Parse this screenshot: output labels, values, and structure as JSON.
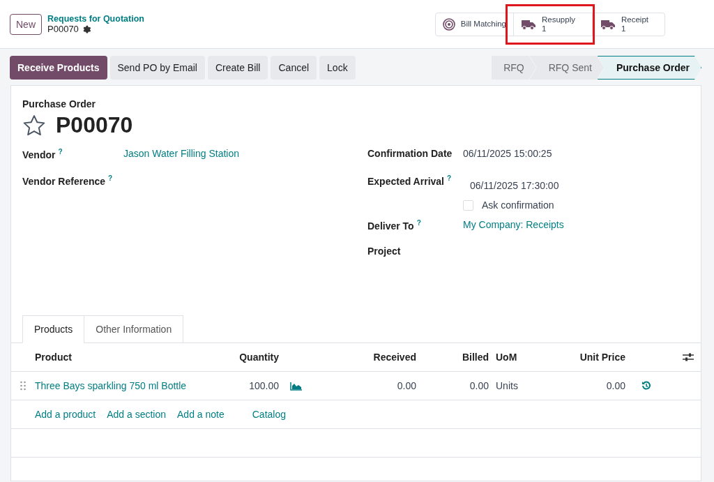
{
  "control_panel": {
    "new_button": "New",
    "breadcrumb_parent": "Requests for Quotation",
    "breadcrumb_current": "P00070"
  },
  "smart_buttons": [
    {
      "kind": "target",
      "label": "Bill Matching",
      "highlighted": false
    },
    {
      "kind": "truck",
      "label": "Resupply",
      "count": "1",
      "highlighted": true
    },
    {
      "kind": "truck",
      "label": "Receipt",
      "count": "1",
      "highlighted": false
    }
  ],
  "actions": [
    {
      "label": "Receive Products",
      "primary": true
    },
    {
      "label": "Send PO by Email",
      "primary": false
    },
    {
      "label": "Create Bill",
      "primary": false
    },
    {
      "label": "Cancel",
      "primary": false
    },
    {
      "label": "Lock",
      "primary": false
    }
  ],
  "status_bar": [
    {
      "label": "RFQ",
      "selected": false
    },
    {
      "label": "RFQ Sent",
      "selected": false
    },
    {
      "label": "Purchase Order",
      "selected": true
    }
  ],
  "form": {
    "caption": "Purchase Order",
    "name": "P00070",
    "starred": false,
    "left_fields": [
      {
        "label": "Vendor",
        "help": "?",
        "value": "Jason Water Filling Station",
        "kind": "link"
      },
      {
        "label": "Vendor Reference",
        "help": "?",
        "kind": "empty"
      }
    ],
    "right_fields": [
      {
        "label": "Confirmation Date",
        "value": "06/11/2025 15:00:25",
        "kind": "text"
      },
      {
        "label": "Expected Arrival",
        "help": "?",
        "value": "06/11/2025 17:30:00",
        "kind": "date",
        "checkbox": {
          "label": "Ask confirmation",
          "checked": false
        }
      },
      {
        "label": "Deliver To",
        "help": "?",
        "value": "My Company: Receipts",
        "kind": "link"
      },
      {
        "label": "Project",
        "kind": "empty"
      }
    ]
  },
  "tabs": [
    {
      "label": "Products",
      "selected": true
    },
    {
      "label": "Other Information",
      "selected": false
    }
  ],
  "table": {
    "columns": [
      "Product",
      "Quantity",
      "Received",
      "Billed",
      "UoM",
      "Unit Price"
    ],
    "rows": [
      {
        "product": "Three Bays sparkling 750 ml Bottle",
        "quantity": "100.00",
        "received": "0.00",
        "billed": "0.00",
        "uom": "Units",
        "unit_price": "0.00"
      }
    ],
    "add_links": [
      "Add a product",
      "Add a section",
      "Add a note",
      "Catalog"
    ]
  }
}
